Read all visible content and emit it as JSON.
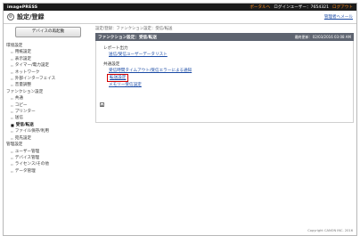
{
  "topbar": {
    "brand": "imagePRESS",
    "portal_link": "ポータルへ",
    "login_user": "ログインユーザー：7654321",
    "logout": "ログアウト"
  },
  "header": {
    "title": "設定/登録",
    "manager_mail": "管理者へメール"
  },
  "sidebar": {
    "portal_button": "デバイスの再起動",
    "sections": [
      {
        "title": "環境設定",
        "items": [
          "用紙設定",
          "表示設定",
          "タイマー/電力設定",
          "ネットワーク",
          "外部インターフェイス",
          "音量調整"
        ]
      },
      {
        "title": "ファンクション設定",
        "items": [
          "共通",
          "コピー",
          "プリンター",
          "送信",
          "受信/転送",
          "ファイル保存/利用"
        ]
      },
      {
        "title": "宛先設定",
        "items": []
      },
      {
        "title": "管理設定",
        "items": [
          "ユーザー管理",
          "デバイス管理",
          "ライセンス/その他",
          "データ管理"
        ]
      }
    ],
    "active_item": "受信/転送"
  },
  "main": {
    "breadcrumb": "設定/登録：ファンクション設定：受信/転送",
    "panel_title": "ファンクション設定：受信/転送",
    "last_update": "最終更新：02/03/2016 03:08 AM",
    "groups": [
      {
        "title": "レポート出力",
        "links": [
          "送信/受信ユーザーデータリスト"
        ]
      },
      {
        "title": "共通設定",
        "links": [
          "受信時間タイムアウト/受信エラーによる通知",
          "転送設定",
          "メモリー受信設定"
        ]
      }
    ],
    "highlighted_link": "転送設定",
    "copyright": "Copyright CANON INC. 2016"
  }
}
